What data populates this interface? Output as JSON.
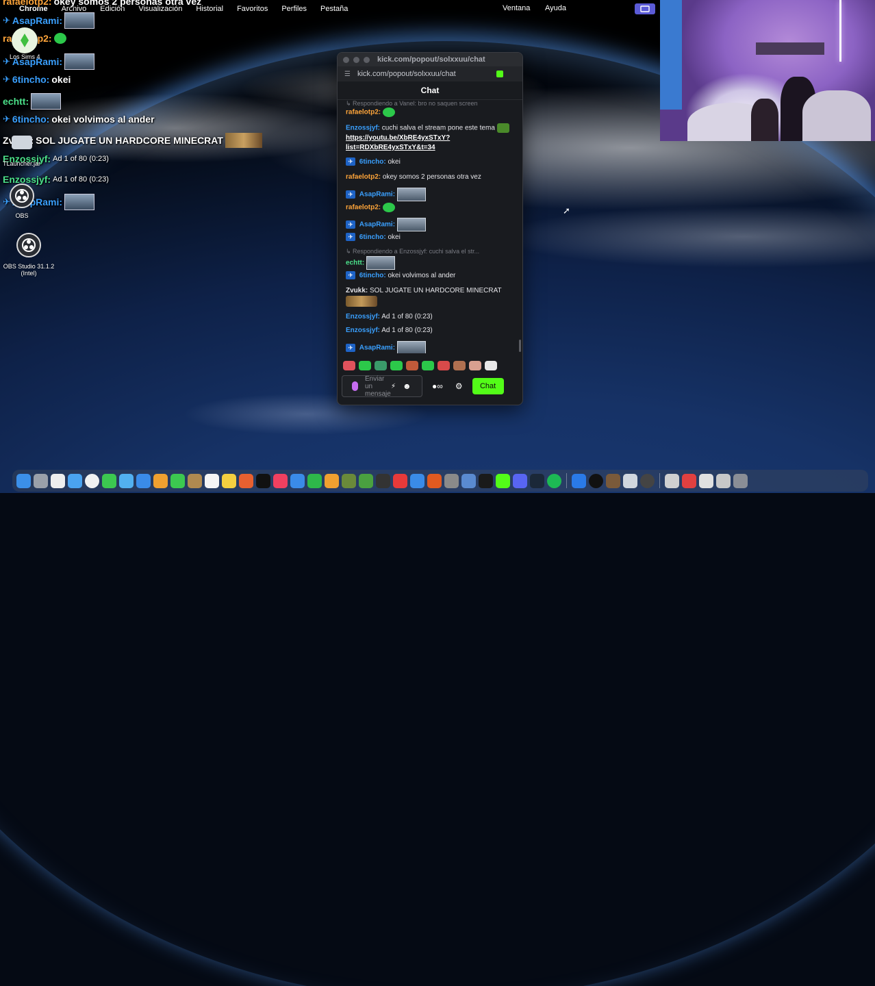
{
  "menubar": {
    "apple": "",
    "app": "Chrome",
    "menus": [
      "Archivo",
      "Edición",
      "Visualización",
      "Historial",
      "Favoritos",
      "Perfiles",
      "Pestaña"
    ],
    "right_menus": [
      "Ventana",
      "Ayuda"
    ]
  },
  "overlay": {
    "lines": [
      {
        "user": "rafaelotp2:",
        "text": "okey somos 2 personas otra vez"
      },
      {
        "user": "AsapRami:",
        "text": ""
      },
      {
        "user": "rafaelotp2:",
        "text": ""
      },
      {
        "user": "AsapRami:",
        "text": ""
      },
      {
        "user": "6tincho:",
        "text": "okei"
      },
      {
        "user": "echtt:",
        "text": ""
      },
      {
        "user": "6tincho:",
        "text": "okei volvimos al ander"
      },
      {
        "user": "Zvukk:",
        "text": "SOL JUGATE UN HARDCORE MINECRAT"
      },
      {
        "user": "Enzossjyf:",
        "text": "Ad 1 of 80 (0:23)"
      },
      {
        "user": "Enzossjyf:",
        "text": "Ad 1 of 80 (0:23)"
      },
      {
        "user": "AsapRami:",
        "text": ""
      }
    ]
  },
  "desktop_icons": [
    {
      "label": "Los Sims 4"
    },
    {
      "label": "TLauncher.jar"
    },
    {
      "label": "OBS"
    },
    {
      "label": "OBS Studio 31.1.2 (Intel)"
    }
  ],
  "window": {
    "title": "kick.com/popout/solxxuu/chat",
    "url": "kick.com/popout/solxxuu/chat",
    "header": "Chat",
    "messages": [
      {
        "kind": "reply",
        "text": "↳ Respondiendo a Vanel: bro no saquen screen"
      },
      {
        "user": "rafaelotp2:",
        "text": ""
      },
      {
        "user": "Enzossjyf:",
        "text": "cuchi salva el stream pone este tema",
        "link": "https://youtu.be/XbRE4yxSTxY?list=RDXbRE4yxSTxY&t=34"
      },
      {
        "user": "6tincho:",
        "text": "okei"
      },
      {
        "user": "rafaelotp2:",
        "text": "okey somos 2 personas otra vez"
      },
      {
        "user": "AsapRami:",
        "text": ""
      },
      {
        "user": "rafaelotp2:",
        "text": ""
      },
      {
        "user": "AsapRami:",
        "text": ""
      },
      {
        "user": "6tincho:",
        "text": "okei"
      },
      {
        "kind": "reply",
        "text": "↳ Respondiendo a Enzossjyf: cuchi salva el str..."
      },
      {
        "user": "echtt:",
        "text": ""
      },
      {
        "user": "6tincho:",
        "text": "okei volvimos al ander"
      },
      {
        "user": "Zvukk:",
        "text": "SOL JUGATE UN HARDCORE MINECRAT"
      },
      {
        "user": "Enzossjyf:",
        "text": "Ad 1 of 80 (0:23)"
      },
      {
        "user": "Enzossjyf:",
        "text": "Ad 1 of 80 (0:23)"
      },
      {
        "user": "AsapRami:",
        "text": ""
      }
    ],
    "input_placeholder": "Enviar un mensaje",
    "chat_button": "Chat"
  },
  "colors": {
    "kick_green": "#53fc18",
    "user_blue": "#3aa0ff",
    "user_orange": "#ffa53a"
  }
}
